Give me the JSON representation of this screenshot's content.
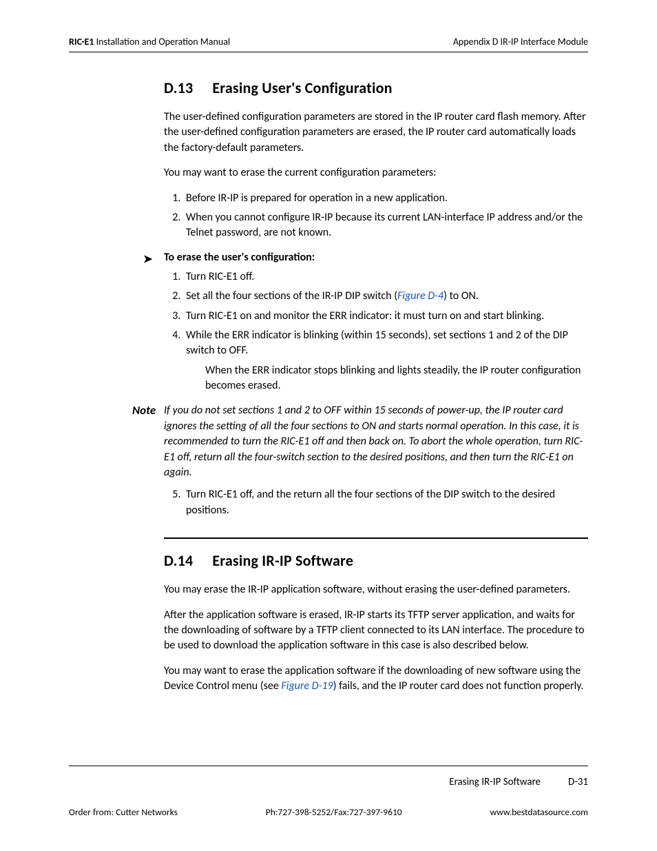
{
  "header": {
    "product": "RIC-E1",
    "manual": " Installation and Operation Manual",
    "appendix": "Appendix D  IR-IP Interface Module"
  },
  "section_d13": {
    "number": "D.13",
    "title": "Erasing User's Configuration",
    "p1": "The user-defined configuration parameters are stored in the IP router card flash memory. After the user-defined configuration parameters are erased, the IP router card automatically loads the factory-default parameters.",
    "p2": "You may want to erase the current configuration parameters:",
    "reasons": [
      "Before IR-IP is prepared for operation in a new application.",
      "When you cannot configure IR-IP because its current LAN-interface IP address and/or the Telnet password, are not known."
    ],
    "proc_title": "To erase the user's configuration:",
    "steps": {
      "s1": "Turn RIC-E1 off.",
      "s2a": "Set all the four sections of the IR-IP DIP switch (",
      "s2_link": "Figure D-4",
      "s2b": ") to ON.",
      "s3": "Turn RIC-E1 on and monitor the ERR indicator: it must turn on and start blinking.",
      "s4": "While the ERR indicator is blinking (within 15 seconds), set sections 1 and 2 of the DIP switch to OFF.",
      "s4_sub": "When the ERR indicator stops blinking and lights steadily, the IP router configuration becomes erased.",
      "s5": "Turn RIC-E1 off, and the return all the four sections of the DIP switch to the desired positions."
    },
    "note_label": "Note",
    "note": "If you do not set sections 1 and 2 to OFF within 15 seconds of power-up, the IP router card ignores the setting of all the four sections to ON and starts normal operation. In this case, it is recommended to turn the RIC-E1 off and then back on. To abort the whole operation, turn RIC-E1 off, return all the four-switch section to the desired positions, and then turn the RIC-E1 on again."
  },
  "section_d14": {
    "number": "D.14",
    "title": "Erasing IR-IP Software",
    "p1": "You may erase the IR-IP application software, without erasing the user-defined parameters.",
    "p2": "After the application software is erased, IR-IP starts its TFTP server application, and waits for the downloading of software by a TFTP client connected to its LAN interface. The procedure to be used to download the application software in this case is also described below.",
    "p3a": "You may want to erase the application software if the downloading of new software using the Device Control menu (see ",
    "p3_link": "Figure D-19",
    "p3b": ") fails, and the IP router card does not function properly."
  },
  "footer": {
    "running_title": "Erasing IR-IP Software",
    "page_num": "D-31",
    "order": "Order from: Cutter Networks",
    "phone": "Ph:727-398-5252/Fax:727-397-9610",
    "url": "www.bestdatasource.com"
  }
}
